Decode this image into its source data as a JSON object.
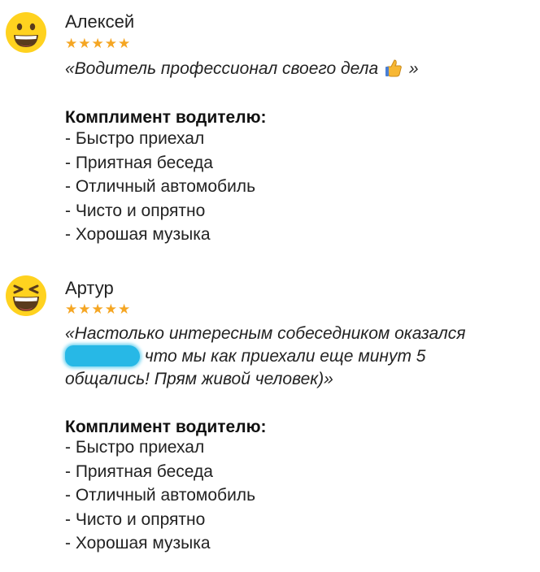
{
  "reviews": [
    {
      "author": "Алексей",
      "stars": "★★★★★",
      "rating": 5,
      "avatar_icon": "grinning-face-emoji-icon",
      "quote_open": "«Водитель профессионал своего дела",
      "quote_emoji": "thumbs-up-icon",
      "quote_close": "»",
      "compliment_title": "Комплимент водителю:",
      "compliments": [
        "- Быстро приехал",
        "- Приятная беседа",
        "- Отличный автомобиль",
        "- Чисто и опрятно",
        "- Хорошая музыка"
      ]
    },
    {
      "author": "Артур",
      "stars": "★★★★★",
      "rating": 5,
      "avatar_icon": "squinting-laughing-face-emoji-icon",
      "quote_part1": "«Настолько интересным собеседником оказался",
      "quote_part2": "что мы как приехали еще минут 5 общались! Прям живой человек)»",
      "redaction_color": "#27b8e6",
      "compliment_title": "Комплимент водителю:",
      "compliments": [
        "- Быстро приехал",
        "- Приятная беседа",
        "- Отличный автомобиль",
        "- Чисто и опрятно",
        "- Хорошая музыка"
      ]
    }
  ],
  "colors": {
    "star": "#f5a623",
    "emoji_face": "#ffd21f",
    "text": "#222222"
  }
}
